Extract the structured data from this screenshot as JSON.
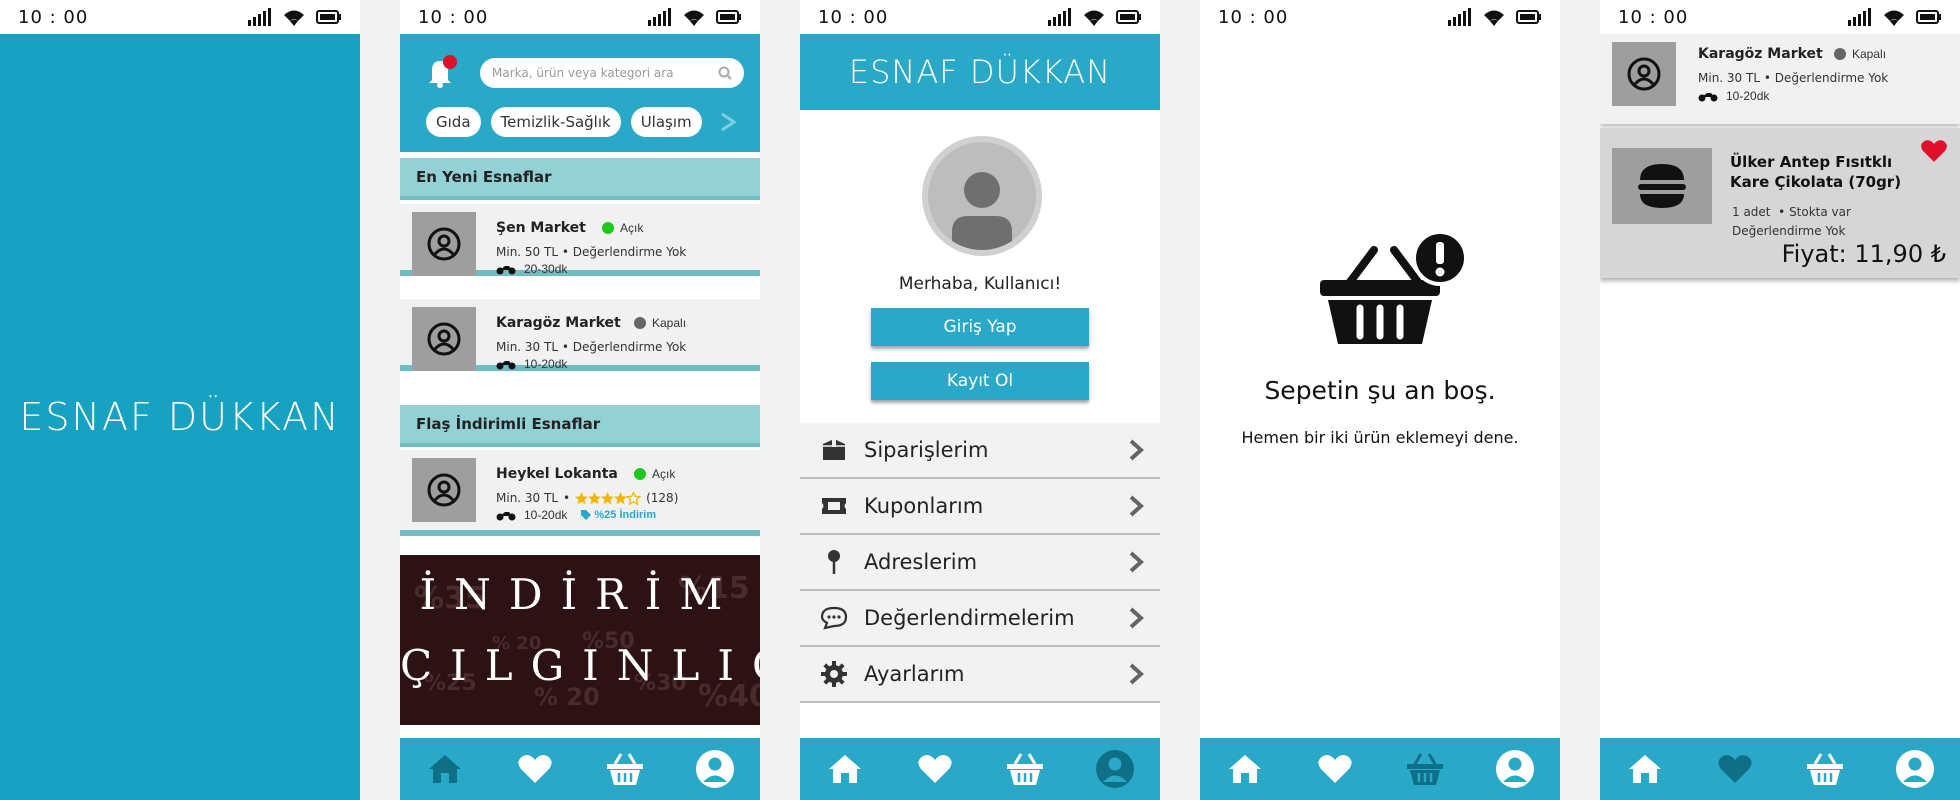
{
  "status_time": "10 : 00",
  "colors": {
    "teal": "#29a9c7",
    "splash": "#17a2c1",
    "section": "#94d1d4",
    "open": "#1ec91e",
    "closed": "#666666",
    "badge": "#e0102a"
  },
  "splash": {
    "title": "ESNAF DÜKKAN"
  },
  "home": {
    "search_placeholder": "Marka, ürün veya kategori ara",
    "categories": [
      "Gıda",
      "Temizlik-Sağlık",
      "Ulaşım"
    ],
    "section_new": "En Yeni Esnaflar",
    "section_flash": "Flaş İndirimli Esnaflar",
    "shops": [
      {
        "name": "Şen Market",
        "status": "Açık",
        "min": "Min. 50 TL",
        "rating": "Değerlendirme Yok",
        "delivery": "20-30dk"
      },
      {
        "name": "Karagöz Market",
        "status": "Kapalı",
        "min": "Min. 30 TL",
        "rating": "Değerlendirme Yok",
        "delivery": "10-20dk"
      }
    ],
    "flash_shop": {
      "name": "Heykel Lokanta",
      "status": "Açık",
      "min": "Min. 30 TL",
      "rating_count": "(128)",
      "stars": 4.5,
      "delivery": "10-20dk",
      "discount": "%25 İndirim"
    },
    "promo": {
      "line1": "İNDİRİM",
      "line2": "ÇILGINLIĞI",
      "bg_texts": [
        "%35",
        "%15",
        "% 20",
        "%50",
        "%25",
        "%30",
        "% 20",
        "%40"
      ]
    }
  },
  "profile": {
    "title": "ESNAF DÜKKAN",
    "greeting": "Merhaba, Kullanıcı!",
    "login": "Giriş Yap",
    "register": "Kayıt Ol",
    "menu": [
      "Siparişlerim",
      "Kuponlarım",
      "Adreslerim",
      "Değerlendirmelerim",
      "Ayarlarım"
    ]
  },
  "cart": {
    "empty_title": "Sepetin şu an boş.",
    "empty_sub": "Hemen bir iki ürün eklemeyi dene."
  },
  "favorites": {
    "shop": {
      "name": "Karagöz Market",
      "status": "Kapalı",
      "min": "Min. 30 TL",
      "rating": "Değerlendirme Yok",
      "delivery": "10-20dk"
    },
    "product": {
      "name": "Ülker Antep Fısıtklı Kare Çikolata (70gr)",
      "qty": "1 adet",
      "stock": "Stokta var",
      "rating": "Değerlendirme Yok",
      "price": "Fiyat:  11,90 ₺"
    }
  },
  "separator": "•"
}
